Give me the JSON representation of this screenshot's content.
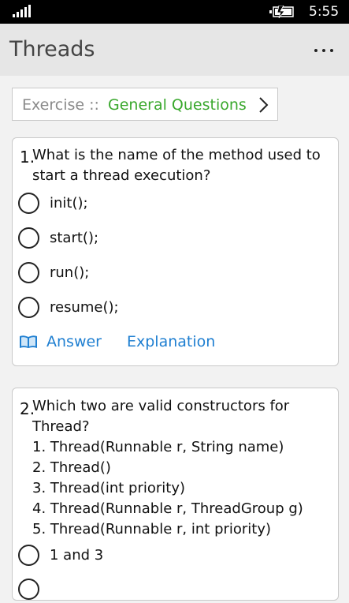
{
  "status_bar": {
    "time": "5:55"
  },
  "app_bar": {
    "title": "Threads",
    "more_label": "..."
  },
  "exercise": {
    "prefix": "Exercise ::",
    "name": "General Questions"
  },
  "question1": {
    "number": "1.",
    "text_line1": "What is the name of the method used to",
    "text_line2": "start a thread execution?",
    "options": [
      "init();",
      "start();",
      "run();",
      "resume();"
    ],
    "answer_label": "Answer",
    "explanation_label": "Explanation"
  },
  "question2": {
    "number": "2.",
    "text_line1": "Which two are valid constructors for",
    "text_line2": "Thread?",
    "items": [
      "1. Thread(Runnable r, String name)",
      "2. Thread()",
      "3. Thread(int priority)",
      "4. Thread(Runnable r, ThreadGroup g)",
      "5. Thread(Runnable r, int priority)"
    ],
    "options": [
      "1 and 3"
    ]
  }
}
